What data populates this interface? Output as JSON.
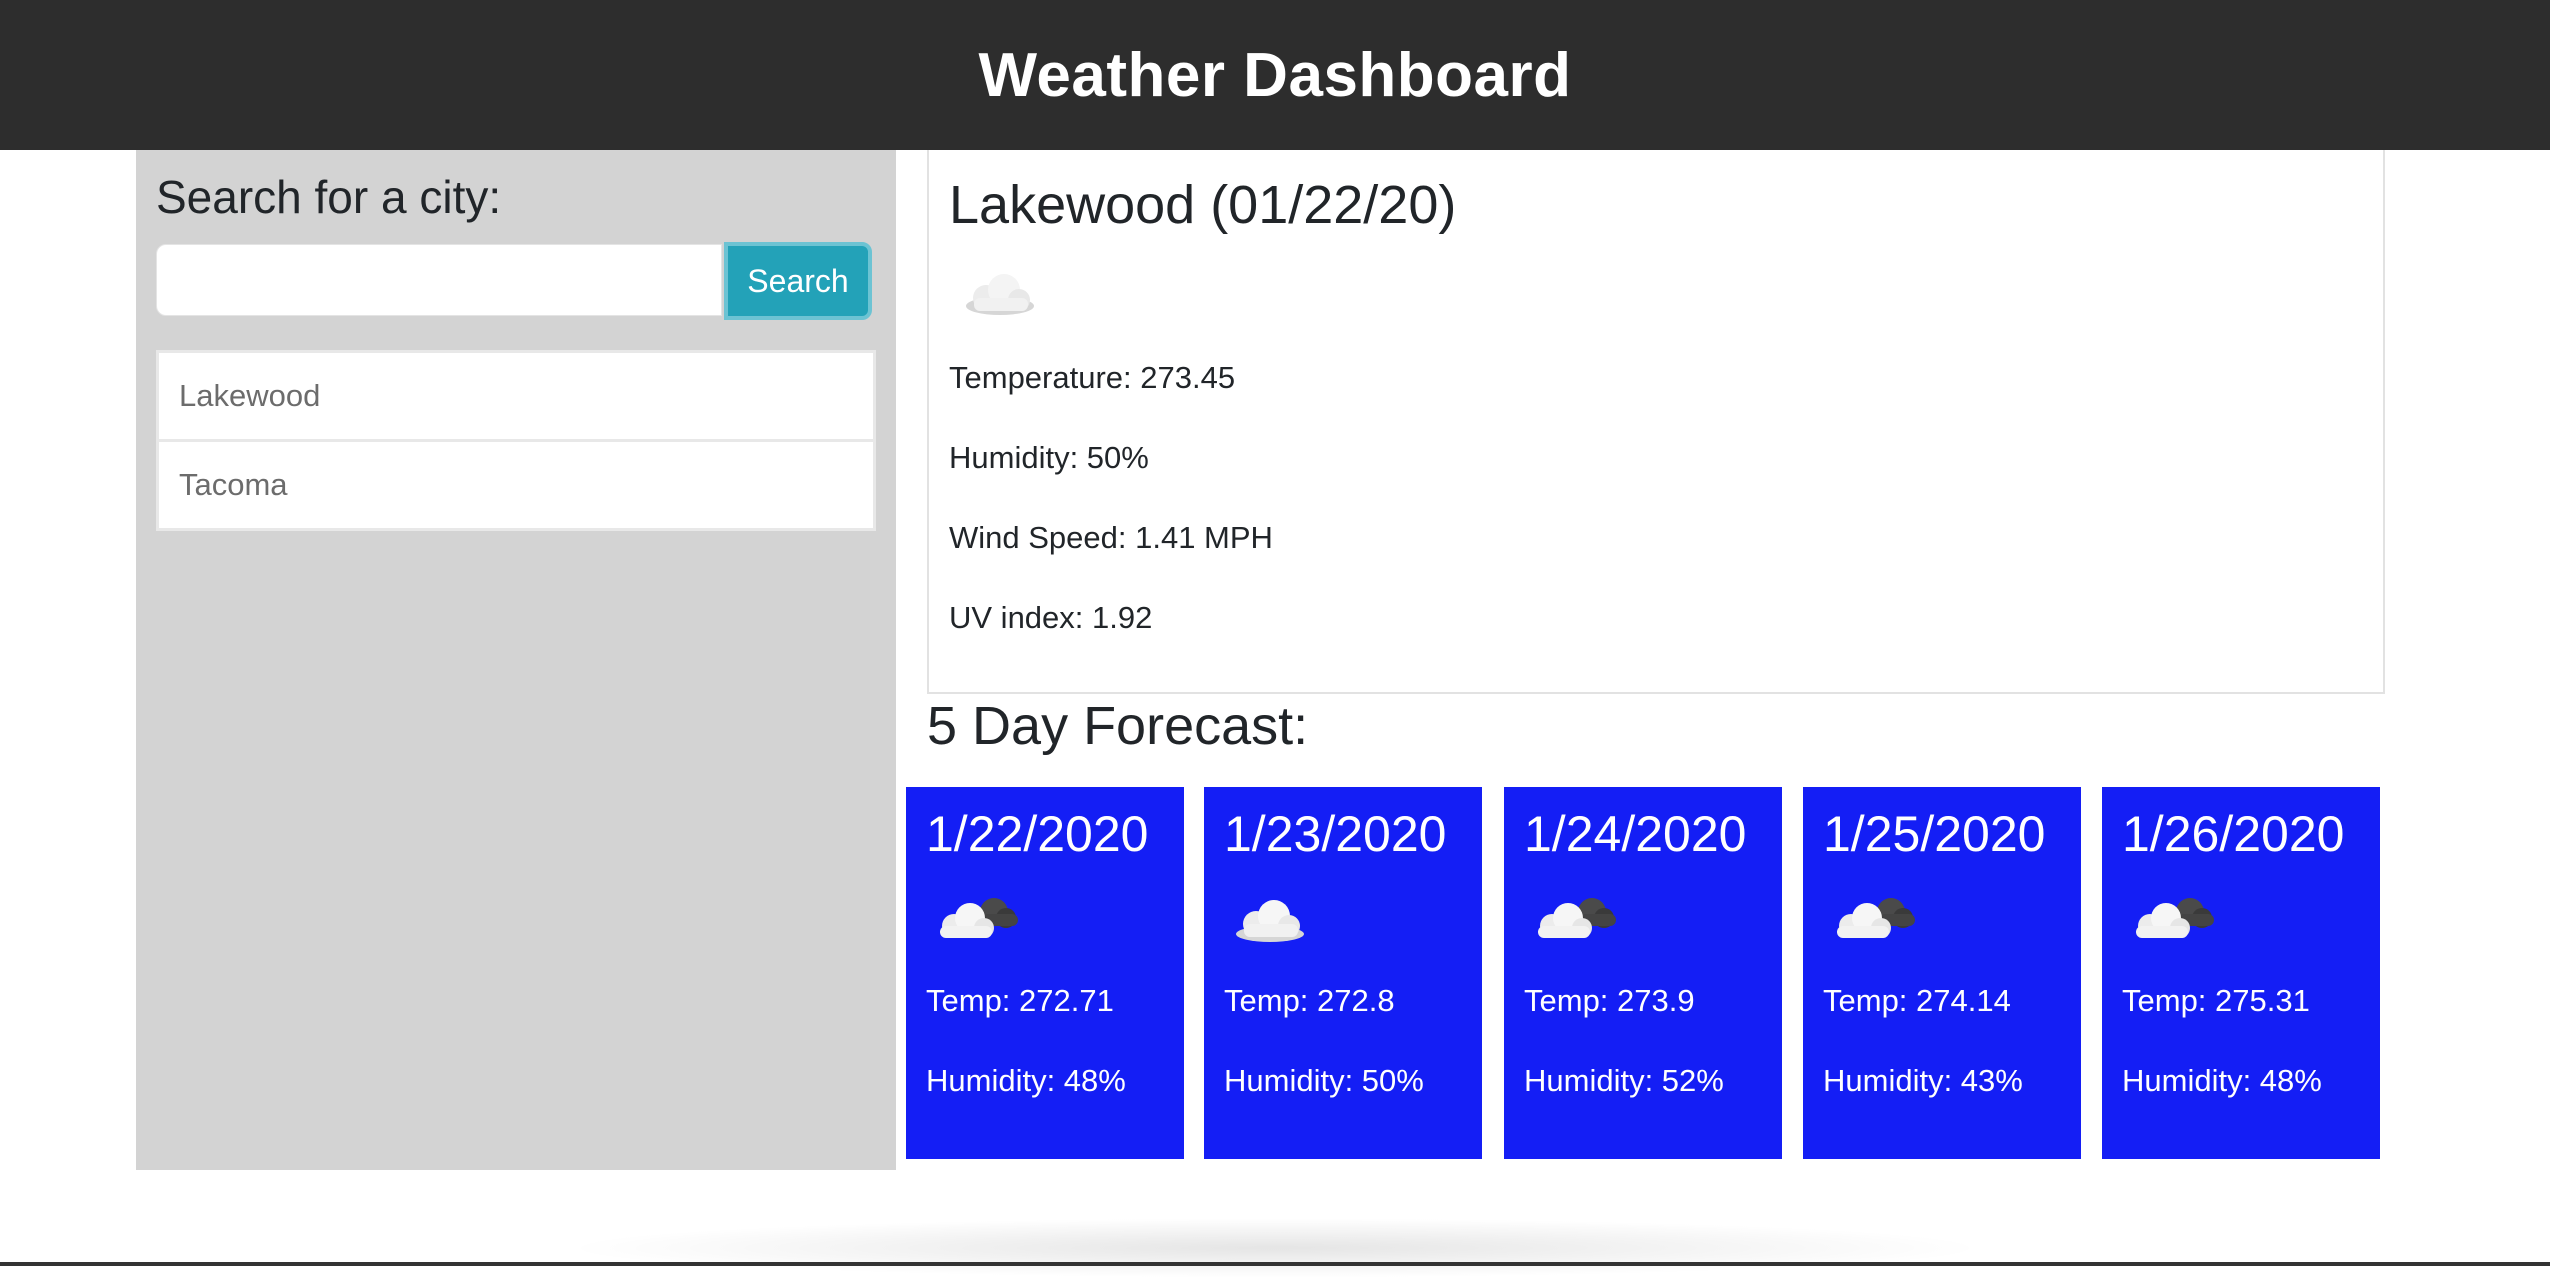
{
  "header": {
    "title": "Weather Dashboard"
  },
  "sidebar": {
    "search_label": "Search for a city:",
    "search_value": "",
    "search_button": "Search",
    "cities": [
      "Lakewood",
      "Tacoma"
    ]
  },
  "current": {
    "title": "Lakewood (01/22/20)",
    "icon": "cloud-icon",
    "temperature": "Temperature: 273.45",
    "humidity": "Humidity: 50%",
    "wind": "Wind Speed: 1.41 MPH",
    "uv": "UV index: 1.92"
  },
  "forecast": {
    "title": "5 Day Forecast:",
    "days": [
      {
        "date": "1/22/2020",
        "icon": "partly-cloudy-icon",
        "temp": "Temp: 272.71",
        "humidity": "Humidity: 48%"
      },
      {
        "date": "1/23/2020",
        "icon": "cloud-icon",
        "temp": "Temp: 272.8",
        "humidity": "Humidity: 50%"
      },
      {
        "date": "1/24/2020",
        "icon": "partly-cloudy-icon",
        "temp": "Temp: 273.9",
        "humidity": "Humidity: 52%"
      },
      {
        "date": "1/25/2020",
        "icon": "partly-cloudy-icon",
        "temp": "Temp: 274.14",
        "humidity": "Humidity: 43%"
      },
      {
        "date": "1/26/2020",
        "icon": "partly-cloudy-icon",
        "temp": "Temp: 275.31",
        "humidity": "Humidity: 48%"
      }
    ]
  },
  "colors": {
    "header": "#2d2d2d",
    "sidebar": "#d3d3d3",
    "button": "#23a2b8",
    "card": "#141ef5"
  }
}
